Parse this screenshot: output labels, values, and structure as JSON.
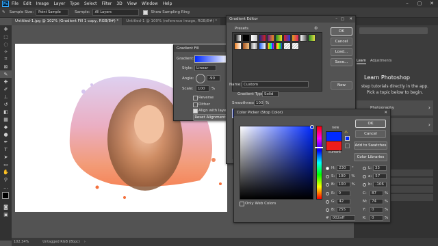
{
  "menubar": {
    "logo": "Ps",
    "items": [
      "File",
      "Edit",
      "Image",
      "Layer",
      "Type",
      "Select",
      "Filter",
      "3D",
      "View",
      "Window",
      "Help"
    ]
  },
  "options": {
    "sample_size_label": "Sample Size:",
    "sample_size_value": "Point Sample",
    "sample_label": "Sample:",
    "sample_value": "All Layers",
    "show_ring_label": "Show Sampling Ring"
  },
  "tabs": [
    {
      "label": "Untitled-1.jpg @ 102% (Gradient Fill 1 copy, RGB/8#) *"
    },
    {
      "label": "Untitled-1 @ 100% (reference image, RGB/8#) *"
    }
  ],
  "status": {
    "zoom": "102.34%",
    "profile": "Untagged RGB (8bpc)"
  },
  "gradient_fill": {
    "title": "Gradient Fill",
    "gradient_label": "Gradient:",
    "style_label": "Style:",
    "style_value": "Linear",
    "angle_label": "Angle:",
    "angle_value": "-90",
    "scale_label": "Scale:",
    "scale_value": "100",
    "scale_unit": "%",
    "reverse_label": "Reverse",
    "dither_label": "Dither",
    "align_label": "Align with layer",
    "reset_label": "Reset Alignment"
  },
  "gradient_editor": {
    "title": "Gradient Editor",
    "presets_label": "Presets",
    "ok": "OK",
    "cancel": "Cancel",
    "load": "Load...",
    "save": "Save...",
    "name_label": "Name:",
    "name_value": "Custom",
    "new": "New",
    "type_label": "Gradient Type:",
    "type_value": "Solid",
    "smooth_label": "Smoothness:",
    "smooth_value": "100",
    "smooth_unit": "%"
  },
  "color_picker": {
    "title": "Color Picker (Stop Color)",
    "ok": "OK",
    "cancel": "Cancel",
    "add_swatches": "Add to Swatches",
    "color_libraries": "Color Libraries",
    "new_label": "new",
    "current_label": "current",
    "web_only": "Only Web Colors",
    "new_color": "#002aff",
    "current_color": "#ee1c1c",
    "hex_value": "002aff",
    "fields": {
      "H": "230",
      "S": "100",
      "B": "100",
      "R": "0",
      "G": "42",
      "Bl": "255",
      "L": "33",
      "a": "57",
      "b": "-106",
      "C": "87",
      "M": "74",
      "Y": "0",
      "K": "0"
    },
    "units": {
      "deg": "°",
      "pct": "%"
    }
  },
  "learn": {
    "tab1": "Learn",
    "tab2": "Adjustments",
    "title": "Learn Photoshop",
    "text": "step tutorials directly in the app. Pick a topic below to begin.",
    "item1": "Photography"
  },
  "colors": {
    "accent": "#31a8ff",
    "stop_blue": "#002aff",
    "stop_red": "#ee1c1c"
  }
}
